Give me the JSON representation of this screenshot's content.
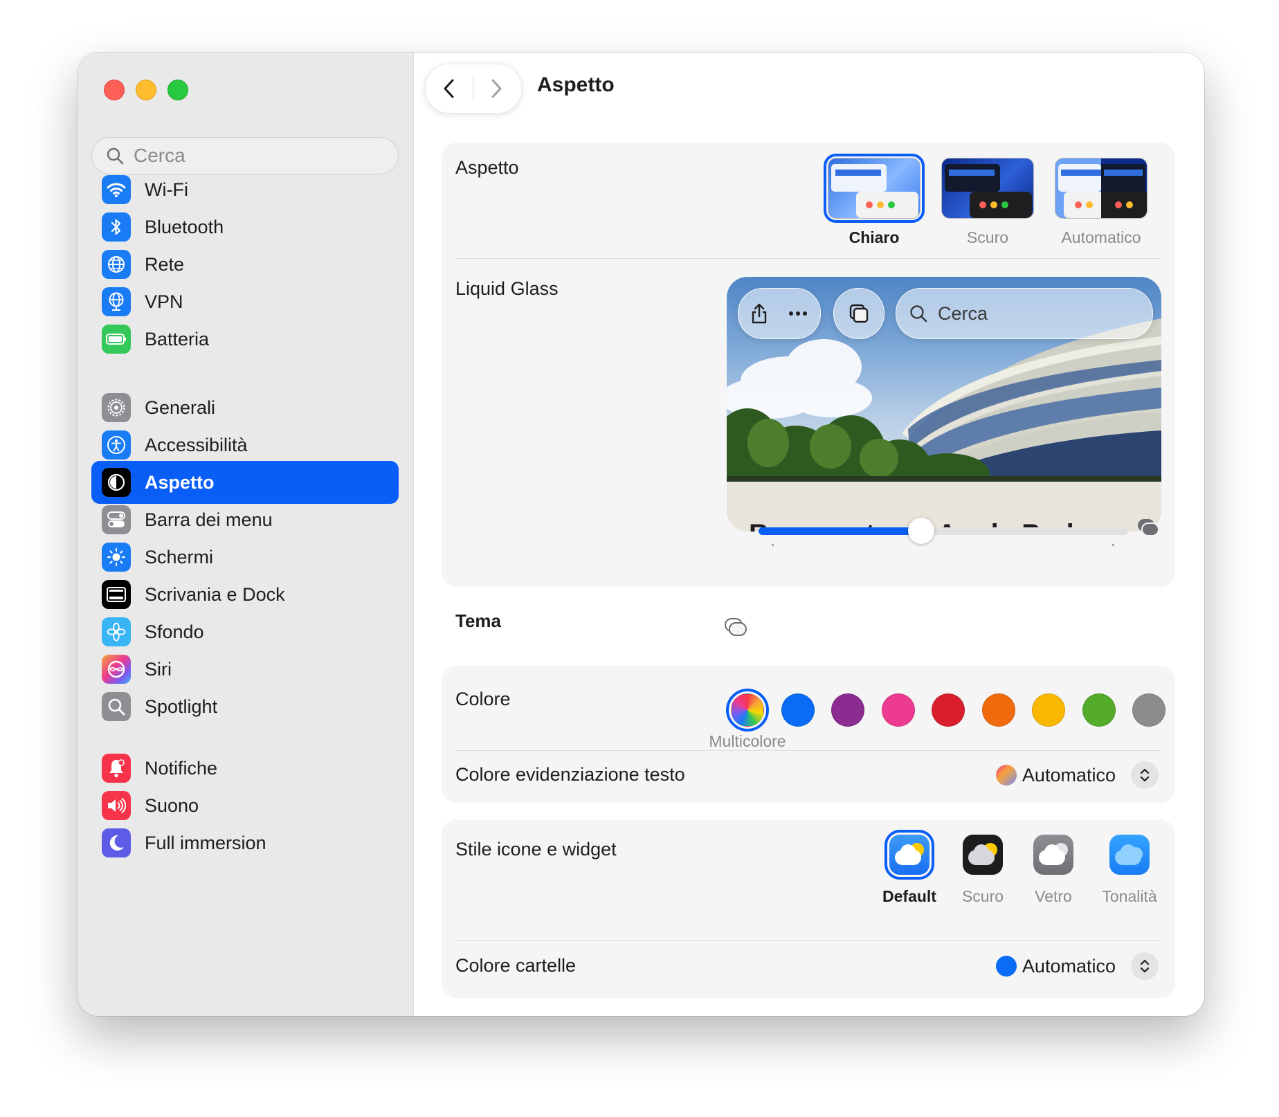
{
  "sidebar": {
    "search": {
      "placeholder": "Cerca"
    },
    "items": [
      {
        "label": "Wi-Fi",
        "icon": "wifi-icon",
        "color": "#1a7cf5"
      },
      {
        "label": "Bluetooth",
        "icon": "bluetooth-icon",
        "color": "#1a7cf5"
      },
      {
        "label": "Rete",
        "icon": "globe-icon",
        "color": "#1a7cf5"
      },
      {
        "label": "VPN",
        "icon": "vpn-globe-icon",
        "color": "#1a7cf5"
      },
      {
        "label": "Batteria",
        "icon": "battery-icon",
        "color": "#34c759"
      },
      {
        "label": "Generali",
        "icon": "gear-icon",
        "color": "#8e8e93"
      },
      {
        "label": "Accessibilità",
        "icon": "accessibility-icon",
        "color": "#1a7cf5"
      },
      {
        "label": "Aspetto",
        "icon": "appearance-icon",
        "color": "#000000",
        "selected": true
      },
      {
        "label": "Barra dei menu",
        "icon": "menubar-toggle-icon",
        "color": "#8e8e93"
      },
      {
        "label": "Schermi",
        "icon": "brightness-icon",
        "color": "#1a7cf5"
      },
      {
        "label": "Scrivania e Dock",
        "icon": "dock-icon",
        "color": "#000000"
      },
      {
        "label": "Sfondo",
        "icon": "flower-icon",
        "color": "#39b4f5"
      },
      {
        "label": "Siri",
        "icon": "siri-icon",
        "color": "#7b5cf0"
      },
      {
        "label": "Spotlight",
        "icon": "magnifier-icon",
        "color": "#8e8e93"
      },
      {
        "label": "Notifiche",
        "icon": "bell-icon",
        "color": "#f7334a"
      },
      {
        "label": "Suono",
        "icon": "speaker-icon",
        "color": "#f7334a"
      },
      {
        "label": "Full immersion",
        "icon": "moon-icon",
        "color": "#5e5ce6"
      }
    ]
  },
  "header": {
    "title": "Aspetto"
  },
  "appearance": {
    "label": "Aspetto",
    "options": [
      {
        "label": "Chiaro",
        "selected": true
      },
      {
        "label": "Scuro",
        "selected": false
      },
      {
        "label": "Automatico",
        "selected": false
      }
    ]
  },
  "liquid_glass": {
    "label": "Liquid Glass",
    "preview_search_placeholder": "Cerca",
    "preview_heading": "Benvenute ad Apple Park",
    "slider_value": 0.44
  },
  "theme": {
    "heading": "Tema",
    "color_label": "Colore",
    "selected_color_caption": "Multicolore",
    "colors": [
      "multicolor",
      "#0a6cf5",
      "#8b2c91",
      "#ec3b91",
      "#d91f2e",
      "#f26a0e",
      "#f8b800",
      "#55ab2a",
      "#8c8c8c"
    ],
    "highlight_label": "Colore evidenziazione testo",
    "highlight_value": "Automatico"
  },
  "icon_style": {
    "label": "Stile icone e widget",
    "options": [
      {
        "label": "Default",
        "selected": true
      },
      {
        "label": "Scuro",
        "selected": false
      },
      {
        "label": "Vetro",
        "selected": false
      },
      {
        "label": "Tonalità",
        "selected": false
      }
    ],
    "folder_color_label": "Colore cartelle",
    "folder_color_value": "Automatico"
  },
  "colors": {
    "accent": "#0a5ef8"
  }
}
